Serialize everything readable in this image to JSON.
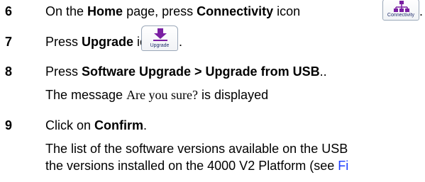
{
  "steps": [
    {
      "number": "6",
      "text_before": "On the ",
      "bold_1": "Home",
      "text_middle": " page, press ",
      "bold_2": "Connectivity",
      "text_after": " icon",
      "icon": {
        "name": "connectivity-icon",
        "caption": "Connectivity"
      },
      "trailing": "."
    },
    {
      "number": "7",
      "text_before": "Press ",
      "bold_1": "Upgrade",
      "text_after": " icon",
      "icon": {
        "name": "upgrade-icon",
        "caption": "Upgrade"
      },
      "trailing": "."
    },
    {
      "number": "8",
      "text_before": "Press ",
      "bold_1": "Software Upgrade > Upgrade from USB",
      "text_after": "..",
      "line2_before": "The message ",
      "line2_serif": "Are you sure?",
      "line2_after": " is displayed"
    },
    {
      "number": "9",
      "text_before": "Click on ",
      "bold_1": "Confirm",
      "text_after": ".",
      "line2": "The list of the software versions available on the USB",
      "line3_before": "the versions installed on the 4000 V2 Platform (see ",
      "line3_link": "Fi"
    }
  ],
  "colors": {
    "text": "#000000",
    "link": "#1a3cff",
    "connectivity_accent": "#7a1fa2",
    "upgrade_accent": "#7a1fa2",
    "caption": "#1f2d6b"
  }
}
